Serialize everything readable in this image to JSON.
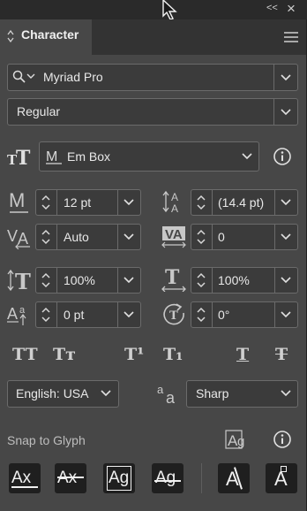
{
  "panel": {
    "title": "Character",
    "collapse_glyph": "<<",
    "close_glyph": "×"
  },
  "font": {
    "family": "Myriad Pro",
    "style": "Regular"
  },
  "em_box": {
    "value": "Em Box"
  },
  "fields": {
    "font_size": "12 pt",
    "leading": "(14.4 pt)",
    "kerning": "Auto",
    "tracking": "0",
    "vertical_scale": "100%",
    "horizontal_scale": "100%",
    "baseline_shift": "0 pt",
    "rotation": "0°"
  },
  "language": "English: USA",
  "antialias": "Sharp",
  "aa_glyph": "a",
  "snap": {
    "label": "Snap to Glyph"
  },
  "icons_meta": {
    "caps_glyph": "TT",
    "smallcaps_glyph": "Tт",
    "super_glyph": "T¹",
    "sub_glyph": "T₁",
    "underline_glyph": "T",
    "strike_glyph": "T",
    "snap_ax": "Ax",
    "snap_ag": "Ag",
    "snap_a": "A"
  }
}
